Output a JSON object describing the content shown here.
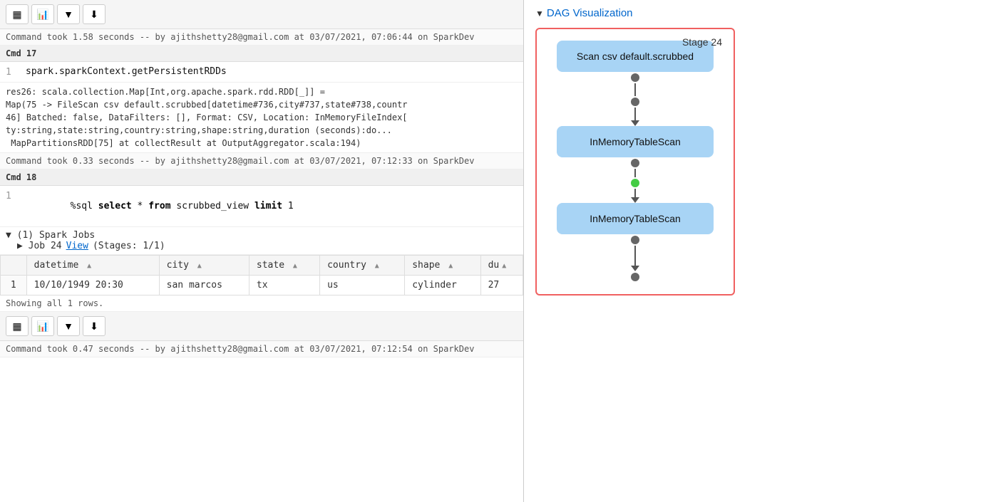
{
  "toolbar1": {
    "buttons": [
      "table-icon",
      "bar-chart-icon",
      "dropdown-icon",
      "download-icon"
    ]
  },
  "cmd17": {
    "header": "Cmd 17",
    "line_num": "1",
    "code": "spark.sparkContext.getPersistentRDDs",
    "output": "res26: scala.collection.Map[Int,org.apache.spark.rdd.RDD[_]] =\nMap(75 -> FileScan csv default.scrubbed[datetime#736,city#737,state#738,countr\n46] Batched: false, DataFilters: [], Format: CSV, Location: InMemoryFileIndex[\nty:string,state:string,country:string,shape:string,duration (seconds):do...\n MapPartitionsRDD[75] at collectResult at OutputAggregator.scala:194)",
    "status": "Command took 0.33 seconds -- by ajithshetty28@gmail.com at 03/07/2021, 07:12:33 on SparkDev"
  },
  "status17": "Command took 1.58 seconds -- by ajithshetty28@gmail.com at 03/07/2021, 07:06:44 on SparkDev",
  "cmd18": {
    "header": "Cmd 18",
    "line_num": "1",
    "code_prefix": "%sql ",
    "code_kw1": "select",
    "code_mid": " * ",
    "code_kw2": "from",
    "code_mid2": " scrubbed_view ",
    "code_kw3": "limit",
    "code_end": " 1"
  },
  "spark_jobs": {
    "header": "▼ (1) Spark Jobs",
    "job_label": "▶ Job 24",
    "job_link": "View",
    "job_stages": "(Stages: 1/1)"
  },
  "table": {
    "columns": [
      "datetime",
      "city",
      "state",
      "country",
      "shape",
      "du"
    ],
    "rows": [
      {
        "num": "1",
        "datetime": "10/10/1949 20:30",
        "city": "san marcos",
        "state": "tx",
        "country": "us",
        "shape": "cylinder",
        "du": "27"
      }
    ]
  },
  "showing_text": "Showing all 1 rows.",
  "toolbar2": {
    "buttons": [
      "table-icon",
      "bar-chart-icon",
      "dropdown-icon",
      "download-icon"
    ]
  },
  "status18": "Command took 0.47 seconds -- by ajithshetty28@gmail.com at 03/07/2021, 07:12:54 on SparkDev",
  "dag": {
    "title": "DAG Visualization",
    "stage_label": "Stage 24",
    "nodes": [
      "Scan csv default.scrubbed",
      "InMemoryTableScan",
      "InMemoryTableScan"
    ]
  }
}
